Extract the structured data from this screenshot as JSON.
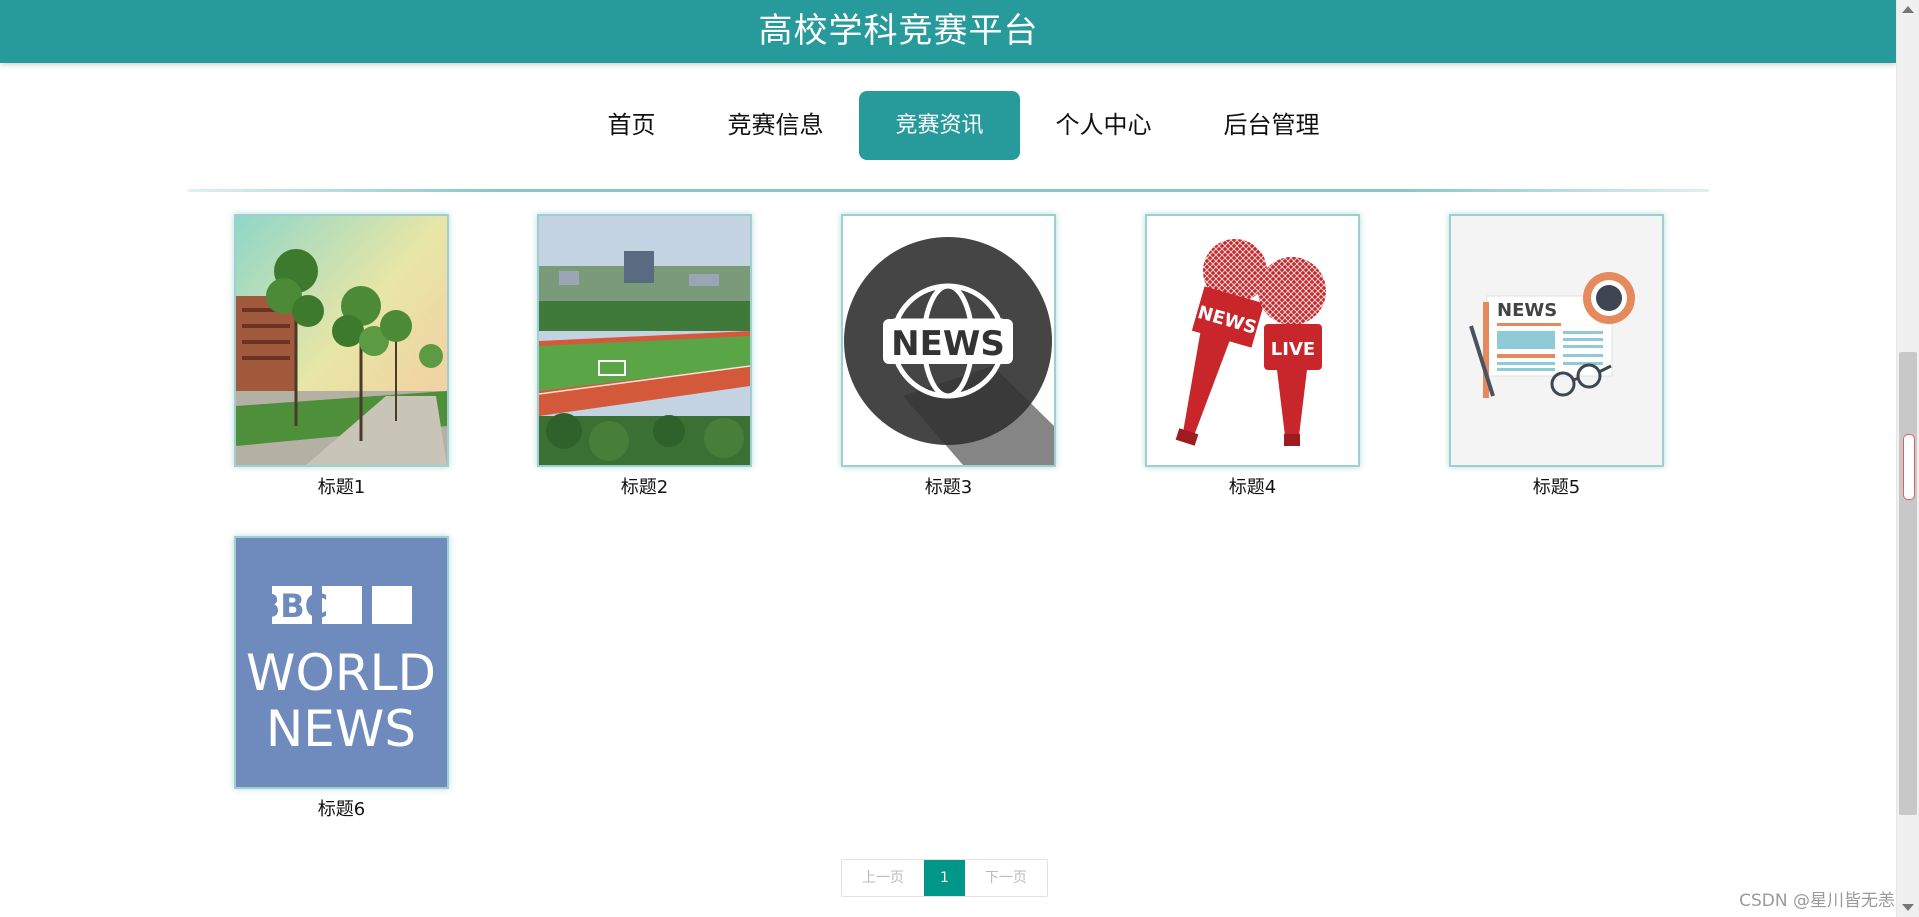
{
  "header": {
    "title": "高校学科竞赛平台",
    "color": "#279a9c"
  },
  "nav": {
    "items": [
      {
        "label": "首页",
        "active": false
      },
      {
        "label": "竞赛信息",
        "active": false
      },
      {
        "label": "竞赛资讯",
        "active": true
      },
      {
        "label": "个人中心",
        "active": false
      },
      {
        "label": "后台管理",
        "active": false
      }
    ]
  },
  "news": [
    {
      "title": "标题1",
      "image": "campus-trees-photo"
    },
    {
      "title": "标题2",
      "image": "sports-track-photo"
    },
    {
      "title": "标题3",
      "image": "news-globe-icon"
    },
    {
      "title": "标题4",
      "image": "news-live-microphones"
    },
    {
      "title": "标题5",
      "image": "newspaper-desk-illustration"
    },
    {
      "title": "标题6",
      "image": "bbc-world-news-logo",
      "image_text": [
        "BBC",
        "WORLD",
        "NEWS"
      ]
    }
  ],
  "icon_text": {
    "globe": "NEWS",
    "mic_flag": "NEWS",
    "mic_live": "LIVE",
    "newspaper": "NEWS"
  },
  "pagination": {
    "prev_label": "上一页",
    "current_page": "1",
    "next_label": "下一页",
    "accent": "#009688"
  },
  "watermark": "CSDN @星川皆无恙"
}
